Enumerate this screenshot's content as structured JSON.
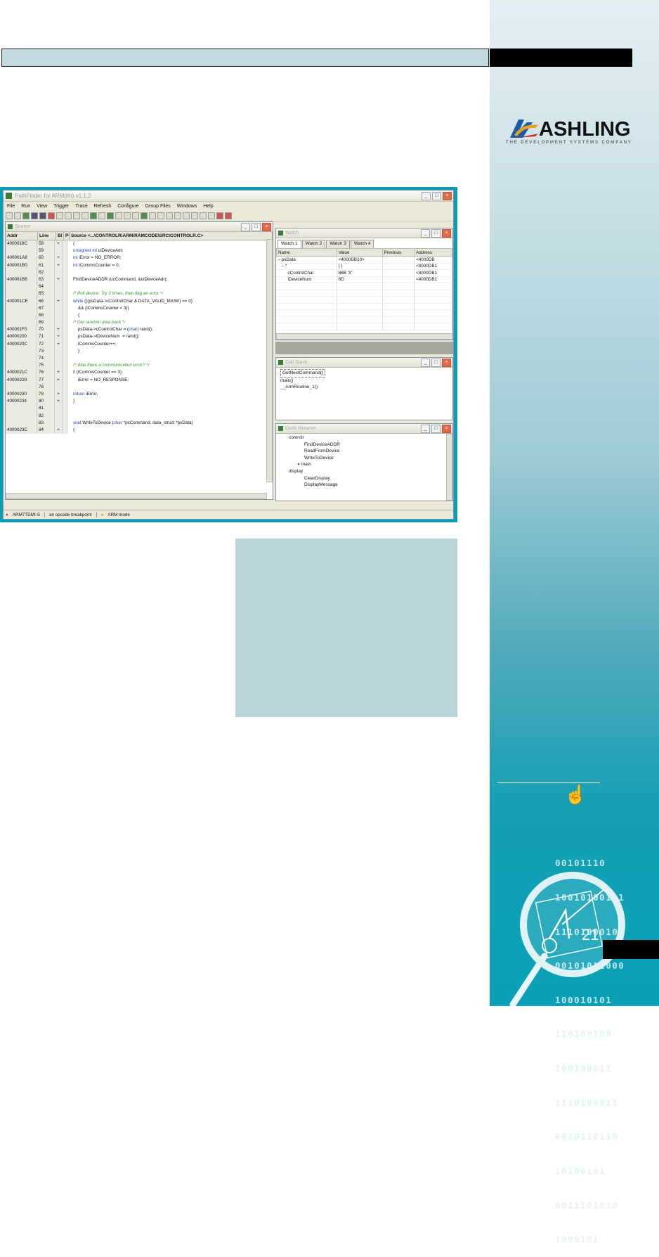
{
  "brand": {
    "name": "ASHLING",
    "tagline": "THE DEVELOPMENT SYSTEMS COMPANY"
  },
  "colors": {
    "sidebar_teal": "#08a0b6",
    "topbar_fill": "#c2d9df",
    "infobox": "#b7d4db"
  },
  "binary_lines": [
    "00101110",
    "10010100101",
    "1110100010",
    "00101011000",
    "100010101",
    "110100100",
    "100100011",
    "1110100011",
    "0010110110",
    "10100101",
    "0011101010",
    "1000101"
  ],
  "app": {
    "title": "PathFinder for ARM(tm) v1.1.2",
    "menu": [
      "File",
      "Run",
      "View",
      "Trigger",
      "Trace",
      "Refresh",
      "Configure",
      "Group Files",
      "Windows",
      "Help"
    ],
    "source": {
      "title": "Source",
      "col_addr": "Addr",
      "col_line": "Line",
      "col_bp": "Bl",
      "col_pc": "PC",
      "col_file": "Source <...\\CONTROLR\\ARM\\RAMCODE\\SRC\\CONTROLR.C>",
      "rows": [
        {
          "addr": "4000018C",
          "line": "58",
          "bp": "+",
          "code": "{",
          "cls": ""
        },
        {
          "addr": "",
          "line": "59",
          "bp": "",
          "code": "unsigned int uiDeviceAdr;",
          "cls": ""
        },
        {
          "addr": "400001A8",
          "line": "60",
          "bp": "+",
          "code": "int iError = NO_ERROR;",
          "cls": ""
        },
        {
          "addr": "400001B0",
          "line": "61",
          "bp": "+",
          "code": "int iCommsCounter = 0;",
          "cls": ""
        },
        {
          "addr": "",
          "line": "62",
          "bp": "",
          "code": "",
          "cls": ""
        },
        {
          "addr": "400001B8",
          "line": "63",
          "bp": "+",
          "code": "FindDeviceADDR (ucCommand, &uiDeviceAdr);",
          "cls": ""
        },
        {
          "addr": "",
          "line": "64",
          "bp": "",
          "code": "",
          "cls": ""
        },
        {
          "addr": "",
          "line": "65",
          "bp": "",
          "code": "/* Poll device: Try 3 times, then flag an error */",
          "cls": "cm"
        },
        {
          "addr": "400001CE",
          "line": "66",
          "bp": "+",
          "code": "while (((psData->cControlChar & DATA_VALID_MASK) == 0)",
          "cls": ""
        },
        {
          "addr": "",
          "line": "67",
          "bp": "",
          "code": "    && (iCommsCounter < 3))",
          "cls": ""
        },
        {
          "addr": "",
          "line": "68",
          "bp": "",
          "code": "    {",
          "cls": ""
        },
        {
          "addr": "",
          "line": "69",
          "bp": "",
          "code": "    /* Get random data back */",
          "cls": "cm"
        },
        {
          "addr": "400001F0",
          "line": "70",
          "bp": "+",
          "code": "    psData->cControlChar = (char) rand();",
          "cls": ""
        },
        {
          "addr": "40000200",
          "line": "71",
          "bp": "+",
          "code": "    psData->iDeviceNum  = rand();",
          "cls": ""
        },
        {
          "addr": "4000020C",
          "line": "72",
          "bp": "+",
          "code": "    iCommsCounter++;",
          "cls": ""
        },
        {
          "addr": "",
          "line": "73",
          "bp": "",
          "code": "    }",
          "cls": ""
        },
        {
          "addr": "",
          "line": "74",
          "bp": "",
          "code": "",
          "cls": ""
        },
        {
          "addr": "",
          "line": "75",
          "bp": "",
          "code": "/* Was there a communication error? */",
          "cls": "cm"
        },
        {
          "addr": "4000021C",
          "line": "76",
          "bp": "+",
          "code": "if (iCommsCounter == 3)",
          "cls": ""
        },
        {
          "addr": "40000228",
          "line": "77",
          "bp": "+",
          "code": "    iError = NO_RESPONSE;",
          "cls": ""
        },
        {
          "addr": "",
          "line": "78",
          "bp": "",
          "code": "",
          "cls": ""
        },
        {
          "addr": "40000230",
          "line": "79",
          "bp": "+",
          "code": "return iError;",
          "cls": ""
        },
        {
          "addr": "40000234",
          "line": "80",
          "bp": "+",
          "code": "}",
          "cls": ""
        },
        {
          "addr": "",
          "line": "81",
          "bp": "",
          "code": "",
          "cls": ""
        },
        {
          "addr": "",
          "line": "82",
          "bp": "",
          "code": "",
          "cls": ""
        },
        {
          "addr": "",
          "line": "83",
          "bp": "",
          "code": "void WriteToDevice (char *pcCommand, data_struct *psData)",
          "cls": ""
        },
        {
          "addr": "4000023C",
          "line": "84",
          "bp": "+",
          "code": "{",
          "cls": ""
        }
      ]
    },
    "watch": {
      "title": "Watch",
      "tabs": [
        "Watch 1",
        "Watch 2",
        "Watch 3",
        "Watch 4"
      ],
      "headers": [
        "Name",
        "Value",
        "Previous",
        "Address"
      ],
      "rows": [
        {
          "name": "– psData",
          "value": "<4000DB10>",
          "prev": "",
          "addr": "<4000DB"
        },
        {
          "name": "   – *",
          "value": "{ }",
          "prev": "",
          "addr": "<4000DB1"
        },
        {
          "name": "        cControlChar",
          "value": "88B 'X'",
          "prev": "",
          "addr": "<4000DB1"
        },
        {
          "name": "        iDeviceNum",
          "value": "8D",
          "prev": "",
          "addr": "<4000DB1"
        }
      ]
    },
    "callstack": {
      "title": "Call Stack",
      "items": [
        "GetNextCommand()",
        "main()",
        "__ArmRoutine_1()"
      ]
    },
    "codebrowser": {
      "title": "Code Browser",
      "items": [
        "controlr",
        "FindDeviceADDR",
        "ReadFromDevice",
        "WriteToDevice",
        "main",
        "display",
        "ClearDisplay",
        "DisplayMessage"
      ]
    },
    "status": [
      "ARM7TDMI-S",
      "an opcode breakpoint",
      "ARM mode"
    ]
  }
}
